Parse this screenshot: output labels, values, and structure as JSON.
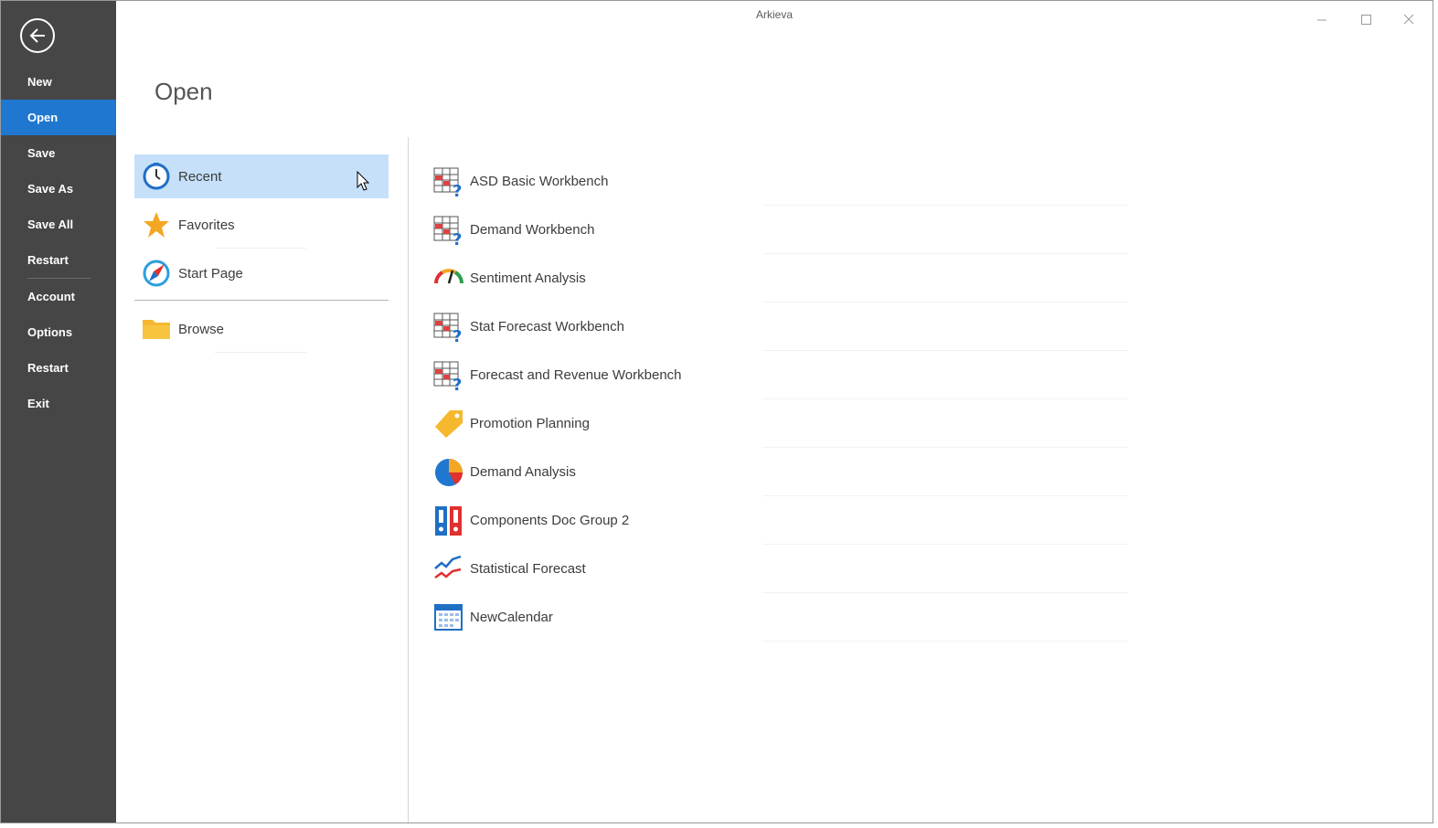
{
  "window": {
    "title": "Arkieva"
  },
  "sidebar": {
    "items": [
      {
        "label": "New"
      },
      {
        "label": "Open",
        "active": true
      },
      {
        "label": "Save"
      },
      {
        "label": "Save As"
      },
      {
        "label": "Save All"
      },
      {
        "label": "Restart"
      },
      {
        "label": "Account"
      },
      {
        "label": "Options"
      },
      {
        "label": "Restart"
      },
      {
        "label": "Exit"
      }
    ]
  },
  "main": {
    "title": "Open",
    "places": [
      {
        "label": "Recent",
        "icon": "clock-icon",
        "selected": true
      },
      {
        "label": "Favorites",
        "icon": "star-icon"
      },
      {
        "label": "Start Page",
        "icon": "compass-icon"
      },
      {
        "label": "Browse",
        "icon": "folder-icon"
      }
    ],
    "recent": [
      {
        "label": "ASD Basic Workbench",
        "icon": "workbench-icon"
      },
      {
        "label": "Demand Workbench",
        "icon": "workbench-icon"
      },
      {
        "label": "Sentiment Analysis",
        "icon": "gauge-icon"
      },
      {
        "label": "Stat Forecast Workbench",
        "icon": "workbench-icon"
      },
      {
        "label": "Forecast and Revenue Workbench",
        "icon": "workbench-icon"
      },
      {
        "label": "Promotion Planning",
        "icon": "tag-icon"
      },
      {
        "label": "Demand Analysis",
        "icon": "pie-chart-icon"
      },
      {
        "label": "Components Doc Group 2",
        "icon": "binders-icon"
      },
      {
        "label": "Statistical Forecast",
        "icon": "line-chart-icon"
      },
      {
        "label": "NewCalendar",
        "icon": "calendar-icon"
      }
    ]
  },
  "colors": {
    "sidebar_bg": "#464646",
    "accent": "#1f77d0",
    "selected_bg": "#c5e0f8"
  }
}
